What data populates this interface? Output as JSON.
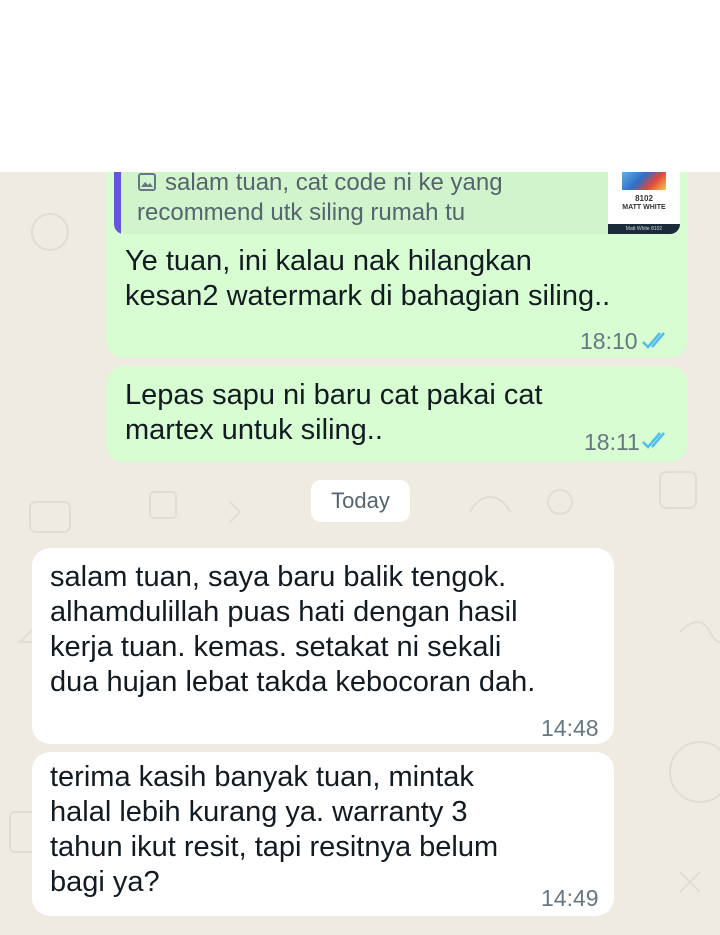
{
  "quoted": {
    "text": "salam tuan, cat code ni ke yang recommend utk siling rumah tu",
    "thumb_code": "8102",
    "thumb_name": "MATT WHITE",
    "thumb_footer": "Matt White 8102",
    "icon": "image-icon"
  },
  "messages": [
    {
      "side": "out",
      "text": "Ye tuan, ini kalau nak hilangkan\nkesan2 watermark di bahagian siling..",
      "time": "18:10",
      "status": "read"
    },
    {
      "side": "out",
      "text": "Lepas sapu ni baru cat pakai cat\nmartex untuk siling..",
      "time": "18:11",
      "status": "read"
    },
    {
      "side": "in",
      "text": "salam tuan, saya baru balik tengok.\nalhamdulillah puas hati dengan hasil\nkerja tuan. kemas. setakat ni sekali\ndua hujan lebat takda kebocoran dah.",
      "time": "14:48"
    },
    {
      "side": "in",
      "text": "terima kasih banyak tuan, mintak\nhalal lebih kurang ya. warranty 3\ntahun ikut resit, tapi resitnya belum\nbagi ya?",
      "time": "14:49"
    }
  ],
  "date_divider": "Today",
  "colors": {
    "outgoing_bubble": "#d9fdd3",
    "incoming_bubble": "#ffffff",
    "wallpaper": "#efeae2",
    "read_ticks": "#53bdeb",
    "quote_bar": "#6556d9"
  }
}
